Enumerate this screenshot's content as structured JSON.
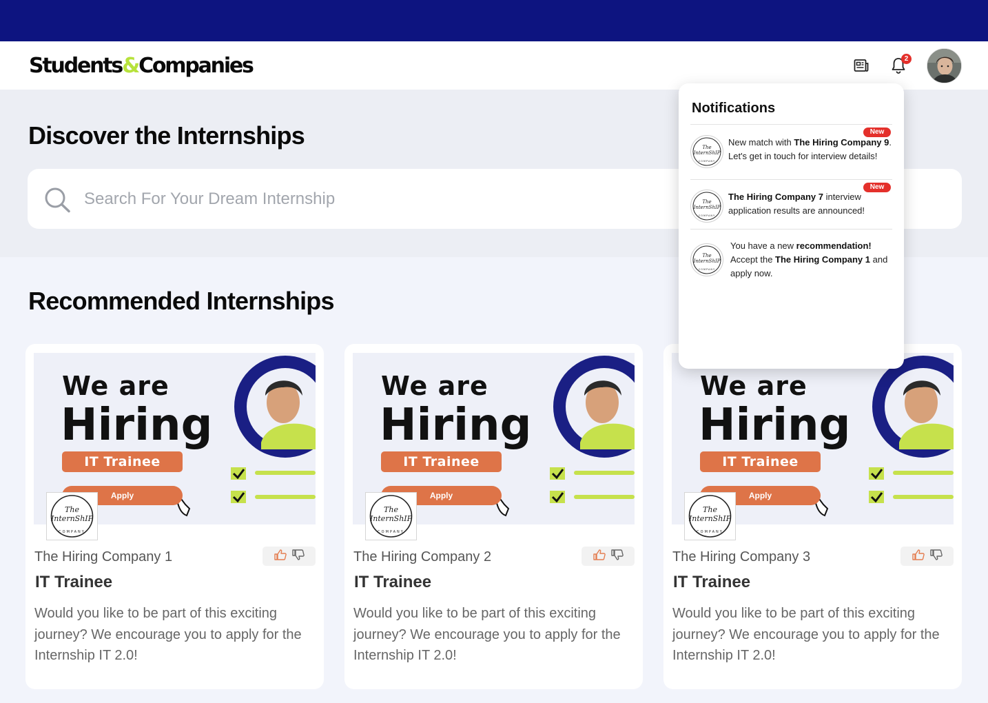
{
  "header": {
    "logo_left": "Students",
    "logo_amp": "&",
    "logo_right": "Companies",
    "bell_count": "2",
    "icons": [
      "news-icon",
      "bell-icon",
      "avatar"
    ]
  },
  "discover": {
    "title": "Discover the Internships",
    "search_placeholder": "Search For Your Dream Internship"
  },
  "recommended": {
    "title": "Recommended Internships",
    "cards": [
      {
        "banner_we": "We are",
        "banner_hiring": "Hiring",
        "banner_role": "IT Trainee",
        "banner_apply": "Apply",
        "company": "The Hiring Company 1",
        "role": "IT Trainee",
        "description": "Would you like to be part of this exciting journey? We encourage you to apply for the Internship IT 2.0!"
      },
      {
        "banner_we": "We are",
        "banner_hiring": "Hiring",
        "banner_role": "IT Trainee",
        "banner_apply": "Apply",
        "company": "The Hiring Company 2",
        "role": "IT Trainee",
        "description": "Would you like to be part of this exciting journey? We encourage you to apply for the Internship IT 2.0!"
      },
      {
        "banner_we": "We are",
        "banner_hiring": "Hiring",
        "banner_role": "IT Trainee",
        "banner_apply": "Apply",
        "company": "The Hiring Company 3",
        "role": "IT Trainee",
        "description": "Would you like to be part of this exciting journey? We encourage you to apply for the Internship IT 2.0!"
      }
    ]
  },
  "notifications": {
    "title": "Notifications",
    "items": [
      {
        "badge": "New",
        "l1a": "New match with ",
        "l1b": "The Hiring Company 9",
        "l1c": ".",
        "l2": "Let's get in touch for interview details!"
      },
      {
        "badge": "New",
        "l1a": "The Hiring Company 7",
        "l1b": " interview",
        "l2": "application results are announced!"
      },
      {
        "l1a": "You have a new ",
        "l1b": "recommendation!",
        "l2a": "Accept the ",
        "l2b": "The Hiring Company 1",
        "l2c": " and",
        "l3": "apply now."
      }
    ]
  },
  "colors": {
    "topbar": "#0d1480",
    "accent_green": "#b7e23c",
    "banner_orange": "#de7448",
    "badge_red": "#e4302b"
  }
}
